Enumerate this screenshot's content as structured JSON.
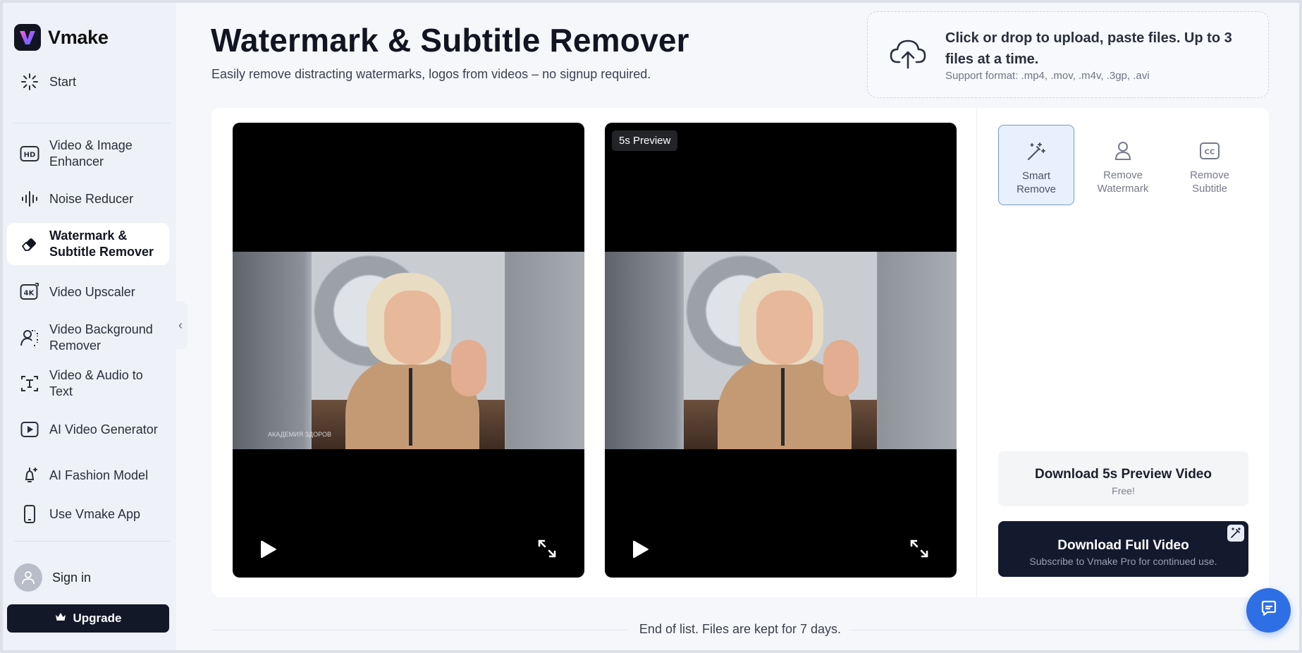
{
  "app": {
    "name": "Vmake"
  },
  "sidebar": {
    "items": [
      {
        "label": "Start",
        "icon": "spinner-icon"
      },
      {
        "label": "Video & Image Enhancer",
        "icon": "hd-icon"
      },
      {
        "label": "Noise Reducer",
        "icon": "waveform-icon"
      },
      {
        "label": "Watermark & Subtitle Remover",
        "icon": "eraser-icon",
        "active": true
      },
      {
        "label": "Video Upscaler",
        "icon": "4k-icon"
      },
      {
        "label": "Video Background Remover",
        "icon": "person-dashed-icon"
      },
      {
        "label": "Video & Audio to Text",
        "icon": "text-scan-icon"
      },
      {
        "label": "AI Video Generator",
        "icon": "play-square-icon"
      },
      {
        "label": "AI Fashion Model",
        "icon": "hanger-sparkle-icon"
      },
      {
        "label": "Use Vmake App",
        "icon": "phone-icon"
      }
    ],
    "sign_in": "Sign in",
    "upgrade": "Upgrade"
  },
  "header": {
    "title": "Watermark & Subtitle Remover",
    "subtitle": "Easily remove distracting watermarks, logos from videos – no signup required."
  },
  "upload": {
    "main": "Click or drop to upload, paste files. Up to 3 files at a time.",
    "formats": "Support format: .mp4, .mov, .m4v, .3gp, .avi"
  },
  "videos": {
    "original_watermark": "АКАДЕМИЯ ЗДОРОВ",
    "preview_badge": "5s Preview"
  },
  "tools": [
    {
      "label": "Smart Remove",
      "icon": "magic-wand-icon",
      "active": true
    },
    {
      "label": "Remove Watermark",
      "icon": "user-outline-icon",
      "active": false
    },
    {
      "label": "Remove Subtitle",
      "icon": "cc-icon",
      "active": false
    }
  ],
  "downloads": {
    "preview_title": "Download 5s Preview Video",
    "preview_sub": "Free!",
    "full_title": "Download Full Video",
    "full_sub": "Subscribe to Vmake Pro for continued use."
  },
  "footer": {
    "end_text": "End of list. Files are kept for 7 days."
  },
  "colors": {
    "accent": "#2f6fe6",
    "dark": "#141a2e",
    "active_tool_bg": "#e8f0fd"
  }
}
